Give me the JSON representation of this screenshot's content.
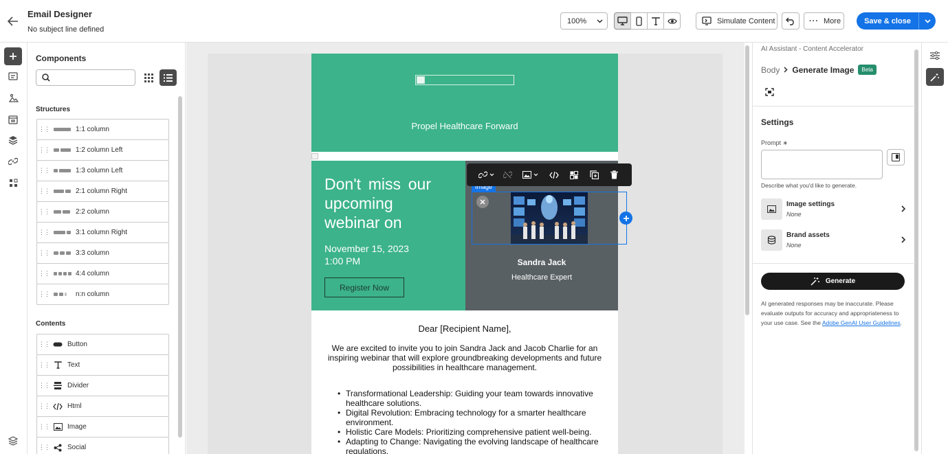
{
  "header": {
    "title": "Email Designer",
    "subtitle": "No subject line defined",
    "zoom": "100%",
    "simulate_label": "Simulate Content",
    "more_label": "More",
    "save_label": "Save & close"
  },
  "components": {
    "title": "Components",
    "search_placeholder": "",
    "structures_heading": "Structures",
    "structures": [
      "1:1 column",
      "1:2 column Left",
      "1:3 column Left",
      "2:1 column Right",
      "2:2 column",
      "3:1 column Right",
      "3:3 column",
      "4:4 column",
      "n:n column"
    ],
    "contents_heading": "Contents",
    "contents": [
      "Button",
      "Text",
      "Divider",
      "Html",
      "Image",
      "Social"
    ]
  },
  "email": {
    "hero_text": "Propel Healthcare Forward",
    "webinar_title": "Don't miss our upcoming webinar on",
    "date_line1": "November 15, 2023",
    "date_line2": "1:00 PM",
    "register_label": "Register Now",
    "speaker_name": "Sandra Jack",
    "speaker_role": "Healthcare Expert",
    "greeting": "Dear [Recipient Name],",
    "intro": "We are excited to invite you to join Sandra Jack and Jacob Charlie for an inspiring webinar that will explore groundbreaking developments and future possibilities in healthcare management.",
    "bullets": [
      "Transformational Leadership: Guiding your team towards innovative healthcare solutions.",
      "Digital Revolution: Embracing technology for a smarter healthcare environment.",
      "Holistic Care Models: Prioritizing comprehensive patient well-being.",
      "Adapting to Change: Navigating the evolving landscape of healthcare regulations."
    ],
    "selected_tag": "Image"
  },
  "assistant": {
    "panel_title": "AI Assistant - Content Accelerator",
    "crumb_body": "Body",
    "crumb_current": "Generate Image",
    "beta": "Beta",
    "settings_heading": "Settings",
    "prompt_label": "Prompt ∗",
    "prompt_hint": "Describe what you'd like to generate.",
    "image_settings_label": "Image settings",
    "image_settings_value": "None",
    "brand_assets_label": "Brand assets",
    "brand_assets_value": "None",
    "generate_label": "Generate",
    "disclaimer": "AI generated responses may be inaccurate. Please evaluate outputs for accuracy and appropriateness to your use case. See the ",
    "disclaimer_link": "Adobe GenAI User Guidelines",
    "disclaimer_end": "."
  },
  "colors": {
    "accent": "#1473e6",
    "email_green": "#3cb38a",
    "speaker_gray": "#596063",
    "beta_badge": "#268e6c"
  }
}
